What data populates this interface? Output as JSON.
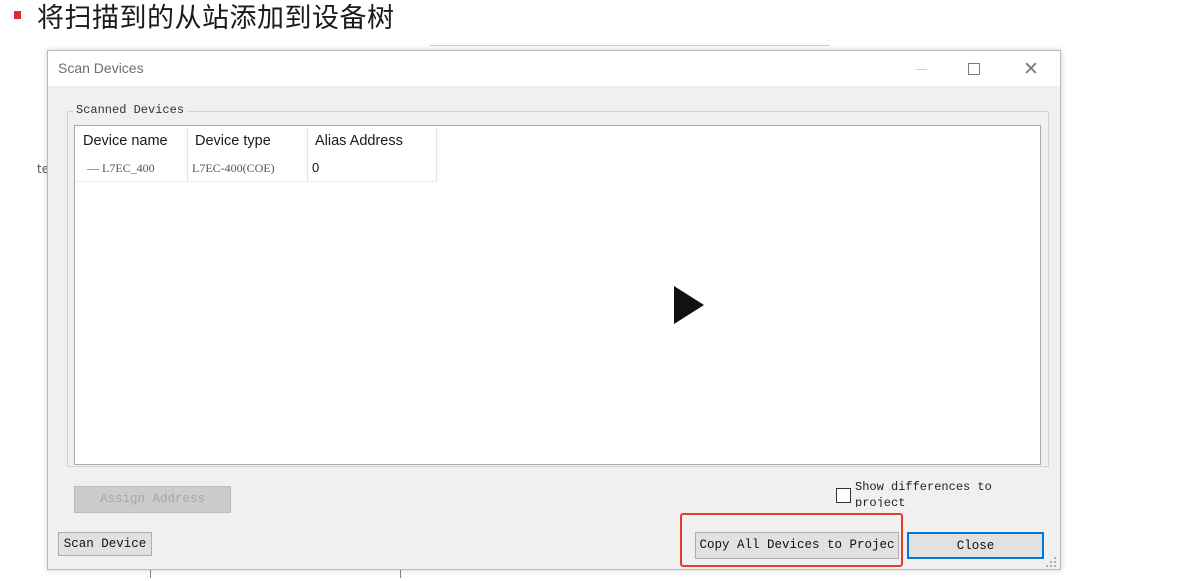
{
  "slide": {
    "title": "将扫描到的从站添加到设备树",
    "accent_color": "#e0262f",
    "side_fragment": "te"
  },
  "dialog": {
    "title": "Scan Devices",
    "window_controls": [
      "minimize-icon",
      "maximize-icon",
      "close-icon"
    ],
    "group_label": "Scanned Devices",
    "columns": [
      "Device name",
      "Device type",
      "Alias Address"
    ],
    "rows": [
      {
        "device_name": "— L7EC_400",
        "device_type": "L7EC-400(COE)",
        "alias_address": "0"
      }
    ],
    "buttons": {
      "assign_address": "Assign Address",
      "scan_device": "Scan Device",
      "copy_all": "Copy All Devices to Projec",
      "close": "Close"
    },
    "checkbox": {
      "label": "Show differences to project",
      "checked": false
    }
  },
  "overlay": {
    "play_icon": "play-icon",
    "highlight_color": "#e63a2e"
  }
}
